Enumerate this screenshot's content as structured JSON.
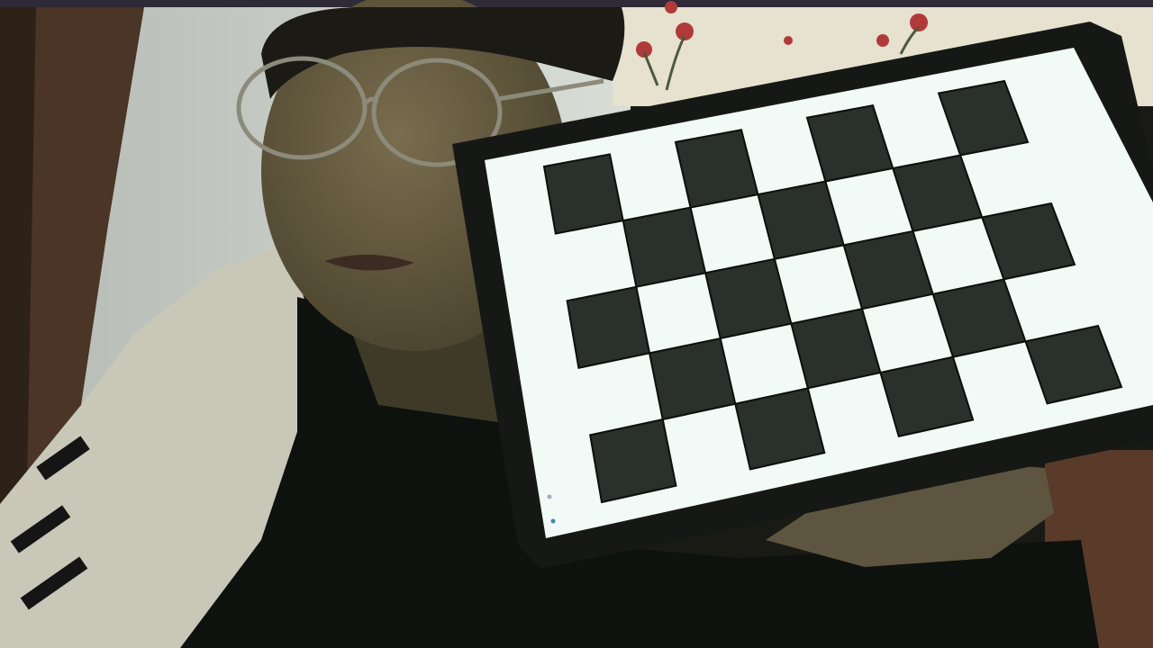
{
  "scene": {
    "description_tag": "webcam-photo",
    "checkerboard": {
      "rows": 5,
      "cols": 7,
      "dark": "#2a302b",
      "light": "#f4fbf8"
    },
    "colors": {
      "wall": "#c9cec8",
      "door": "#4a3526",
      "curtain": "#e6e2cf",
      "skin": "#6f6447",
      "hair": "#1c1a14",
      "shirt": "#0e120e",
      "jacket": "#c8c7b8",
      "bezel": "#151815",
      "screen": "#f2faf7",
      "flower": "#b03a3a"
    }
  }
}
